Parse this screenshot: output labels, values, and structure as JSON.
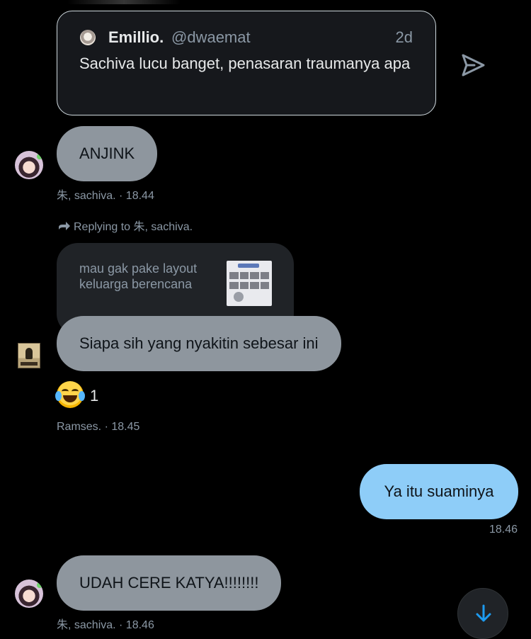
{
  "quoted_tweet": {
    "name": "Emillio.",
    "handle": "@dwaemat",
    "time": "2d",
    "text": "Sachiva lucu banget, penasaran traumanya apa"
  },
  "messages": [
    {
      "sender": "朱, sachiva.",
      "text": "ANJINK",
      "meta": "朱, sachiva. · 18.44"
    },
    {
      "reply_label": "Replying to 朱, sachiva.",
      "reply_preview_text": "mau gak pake layout keluarga berencana",
      "sender": "Ramses.",
      "text": "Siapa sih yang nyakitin sebesar ini",
      "reaction_count": "1",
      "meta": "Ramses. · 18.45"
    },
    {
      "sender": "me",
      "text": "Ya itu suaminya",
      "meta": "18.46"
    },
    {
      "sender": "朱, sachiva.",
      "text": "UDAH CERE KATYA!!!!!!!!",
      "meta": "朱, sachiva. · 18.46"
    }
  ],
  "icons": {
    "share": "send-icon",
    "reply": "reply-arrow-icon",
    "reaction": "joy-emoji-icon",
    "scroll": "arrow-down-icon"
  },
  "colors": {
    "background": "#000000",
    "incoming_bubble": "#8e969e",
    "outgoing_bubble": "#8ecdf8",
    "meta_text": "#8b98a5",
    "scroll_arrow": "#1d9bf0"
  }
}
